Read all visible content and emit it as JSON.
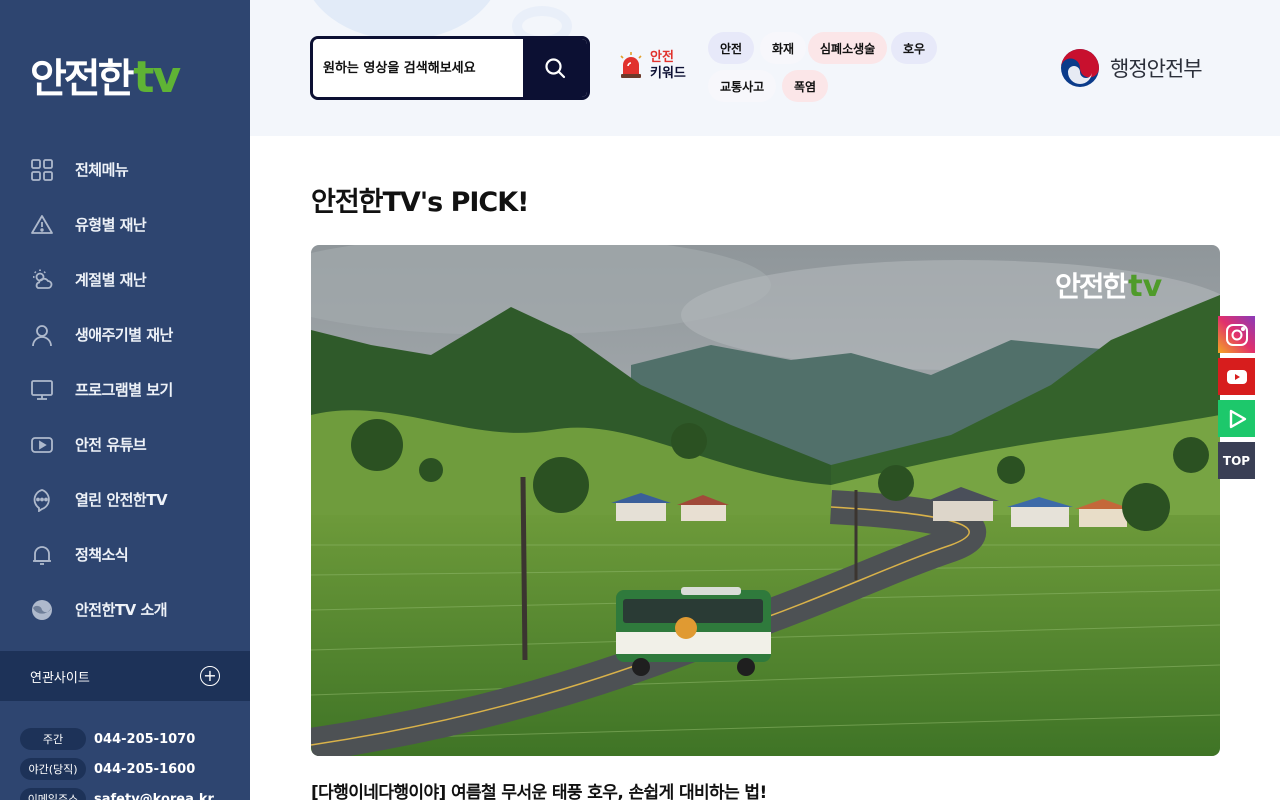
{
  "brand": {
    "logo_ko": "안전한",
    "logo_tv": "tv"
  },
  "sidebar": {
    "items": [
      {
        "label": "전체메뉴",
        "icon": "grid-icon"
      },
      {
        "label": "유형별 재난",
        "icon": "warning-icon"
      },
      {
        "label": "계절별 재난",
        "icon": "weather-icon"
      },
      {
        "label": "생애주기별 재난",
        "icon": "person-icon"
      },
      {
        "label": "프로그램별 보기",
        "icon": "monitor-icon"
      },
      {
        "label": "안전 유튜브",
        "icon": "play-icon"
      },
      {
        "label": "열린 안전한TV",
        "icon": "chat-icon"
      },
      {
        "label": "정책소식",
        "icon": "bell-icon"
      },
      {
        "label": "안전한TV 소개",
        "icon": "emblem-icon"
      }
    ],
    "related_label": "연관사이트",
    "contacts": [
      {
        "tag": "주간",
        "value": "044-205-1070"
      },
      {
        "tag": "야간(당직)",
        "value": "044-205-1600"
      },
      {
        "tag": "이메일주소",
        "value": "safetv@korea.kr"
      }
    ]
  },
  "header": {
    "search_placeholder": "원하는 영상을 검색해보세요",
    "keyword_title_1": "안전",
    "keyword_title_2": "키워드",
    "keywords": [
      "안전",
      "화재",
      "심폐소생술",
      "호우",
      "교통사고",
      "폭염"
    ],
    "ministry": "행정안전부"
  },
  "main": {
    "pick_title": "안전한TV's PICK!",
    "video_title": "[다행이네다행이야] 여름철 무서운 태풍 호우, 손쉽게 대비하는 법!",
    "watermark_ko": "안전한",
    "watermark_tv": "tv"
  },
  "floaters": {
    "top_label": "TOP"
  },
  "colors": {
    "sidebar": "#2e4570",
    "accent_green": "#5fb335",
    "navy": "#0c1033",
    "alert_red": "#e1322d"
  }
}
